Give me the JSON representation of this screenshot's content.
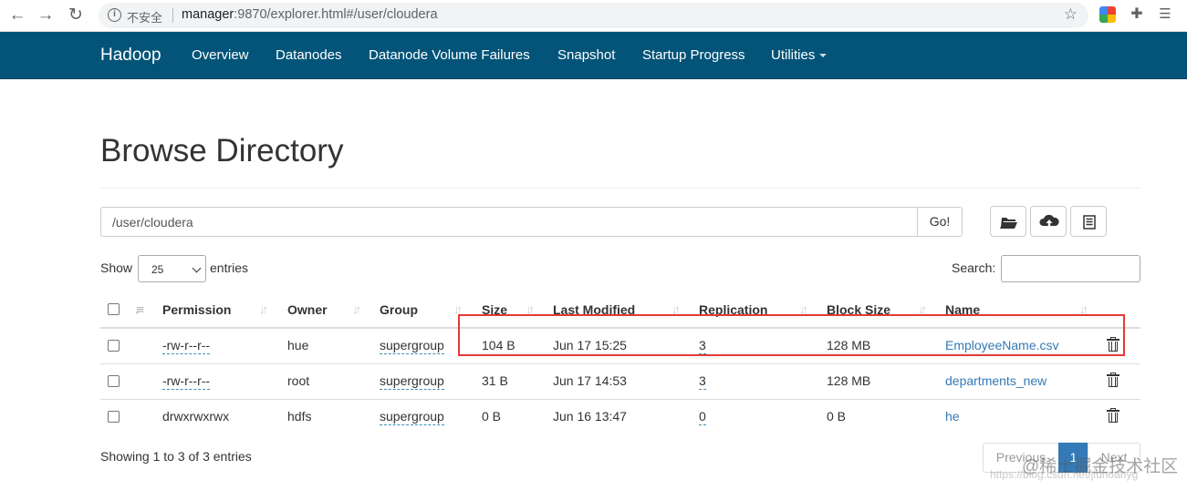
{
  "browser": {
    "insecure_label": "不安全",
    "url_host": "manager",
    "url_rest": ":9870/explorer.html#/user/cloudera"
  },
  "navbar": {
    "brand": "Hadoop",
    "items": [
      {
        "label": "Overview"
      },
      {
        "label": "Datanodes"
      },
      {
        "label": "Datanode Volume Failures"
      },
      {
        "label": "Snapshot"
      },
      {
        "label": "Startup Progress"
      },
      {
        "label": "Utilities"
      }
    ]
  },
  "page": {
    "title": "Browse Directory",
    "path_value": "/user/cloudera",
    "go_label": "Go!"
  },
  "controls": {
    "show_label": "Show",
    "page_size": "25",
    "entries_label": "entries",
    "search_label": "Search:"
  },
  "table": {
    "headers": [
      "Permission",
      "Owner",
      "Group",
      "Size",
      "Last Modified",
      "Replication",
      "Block Size",
      "Name"
    ],
    "rows": [
      {
        "permission": "-rw-r--r--",
        "owner": "hue",
        "group": "supergroup",
        "size": "104 B",
        "modified": "Jun 17 15:25",
        "replication": "3",
        "block_size": "128 MB",
        "name": "EmployeeName.csv"
      },
      {
        "permission": "-rw-r--r--",
        "owner": "root",
        "group": "supergroup",
        "size": "31 B",
        "modified": "Jun 17 14:53",
        "replication": "3",
        "block_size": "128 MB",
        "name": "departments_new"
      },
      {
        "permission": "drwxrwxrwx",
        "owner": "hdfs",
        "group": "supergroup",
        "size": "0 B",
        "modified": "Jun 16 13:47",
        "replication": "0",
        "block_size": "0 B",
        "name": "he"
      }
    ]
  },
  "footer": {
    "showing": "Showing 1 to 3 of 3 entries",
    "prev": "Previous",
    "page": "1",
    "next": "Next"
  },
  "watermark": {
    "text": "@稀土掘金技术社区",
    "url": "https://blog.csdn.net/jiuhoanyg"
  },
  "colors": {
    "navbar": "#035478",
    "link": "#337ab7",
    "highlight": "#e53935"
  }
}
